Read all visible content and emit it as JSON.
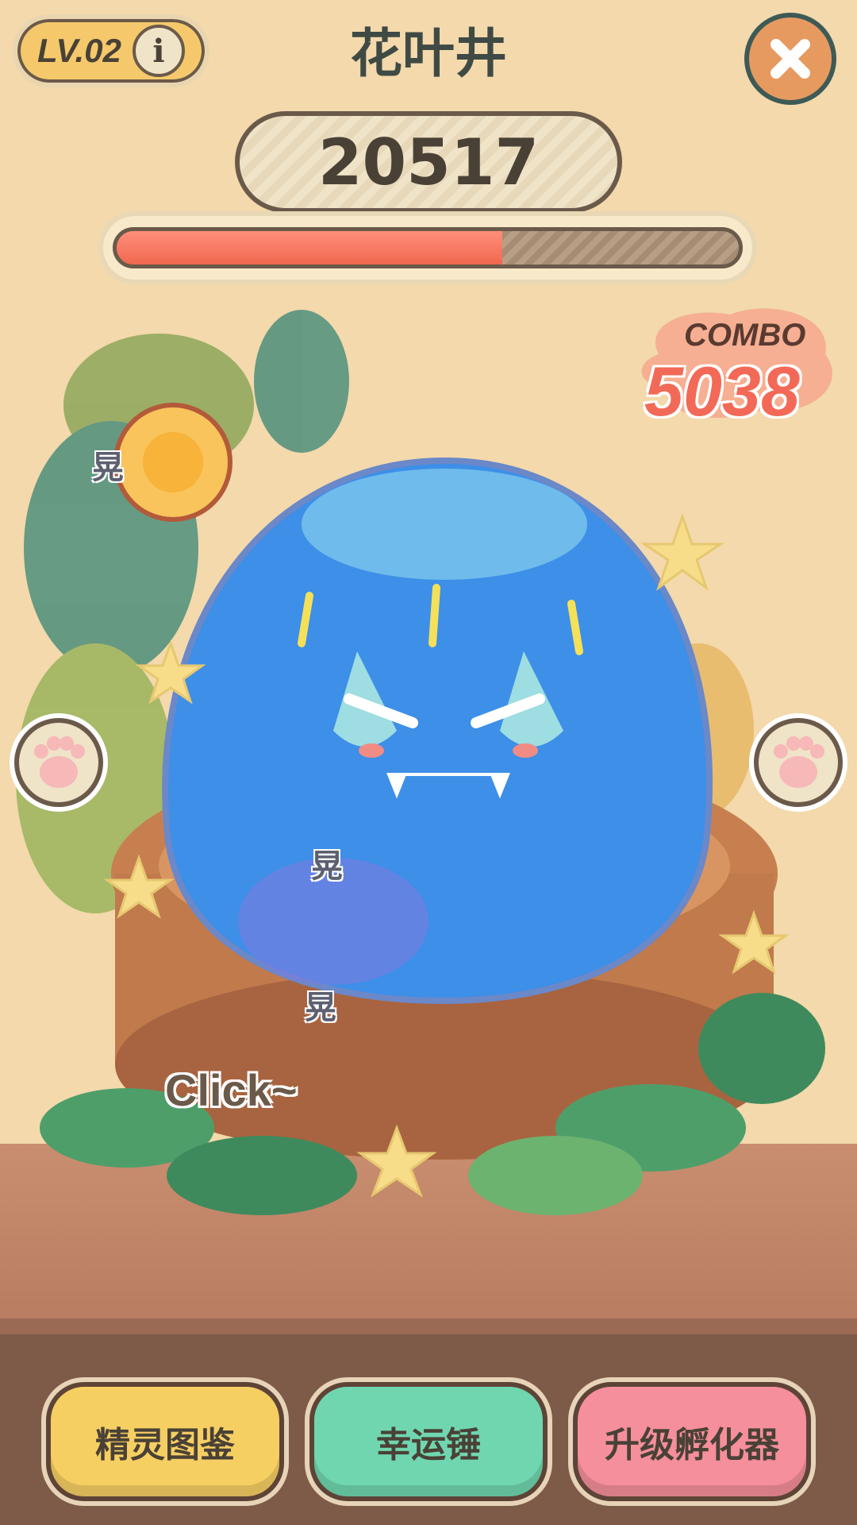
{
  "header": {
    "level": "LV.02",
    "info_icon": "info-icon",
    "title": "花叶井",
    "close_icon": "close-icon"
  },
  "status": {
    "score": "20517",
    "hp_fraction": 0.62
  },
  "combo": {
    "label": "COMBO",
    "value": "5038"
  },
  "floating_words": [
    "晃",
    "晃",
    "晃"
  ],
  "hint": "Click~",
  "buttons": {
    "collection": "精灵图鉴",
    "lucky_hammer": "幸运锤",
    "upgrade_incubator": "升级孵化器"
  },
  "colors": {
    "background": "#f3d9ab",
    "hp_fill": "#f0674f",
    "slime": "#3d8fe8",
    "combo": "#f26a57"
  }
}
